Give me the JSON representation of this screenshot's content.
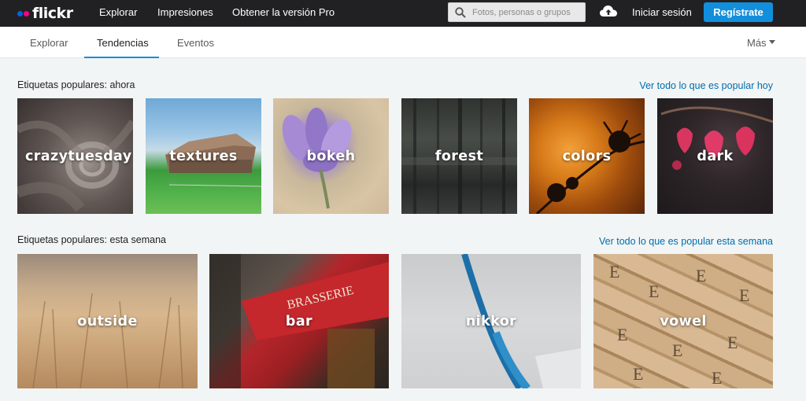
{
  "header": {
    "logo_text": "flickr",
    "nav": [
      "Explorar",
      "Impresiones",
      "Obtener la versión Pro"
    ],
    "search_placeholder": "Fotos, personas o grupos",
    "signin": "Iniciar sesión",
    "register": "Regístrate",
    "colors": {
      "bar": "#212124",
      "register": "#128fdc",
      "dot_blue": "#0063dc",
      "dot_pink": "#ff0084"
    }
  },
  "subnav": {
    "tabs": [
      "Explorar",
      "Tendencias",
      "Eventos"
    ],
    "active_tab": "Tendencias",
    "more": "Más"
  },
  "sections": [
    {
      "title": "Etiquetas populares: ahora",
      "link": "Ver todo lo que es popular hoy",
      "tags": [
        "crazytuesday",
        "textures",
        "bokeh",
        "forest",
        "colors",
        "dark"
      ]
    },
    {
      "title": "Etiquetas populares: esta semana",
      "link": "Ver todo lo que es popular esta semana",
      "tags": [
        "outside",
        "bar",
        "nikkor",
        "vowel"
      ]
    }
  ],
  "icons": [
    "search-icon",
    "upload-cloud-icon",
    "chevron-down-icon"
  ]
}
